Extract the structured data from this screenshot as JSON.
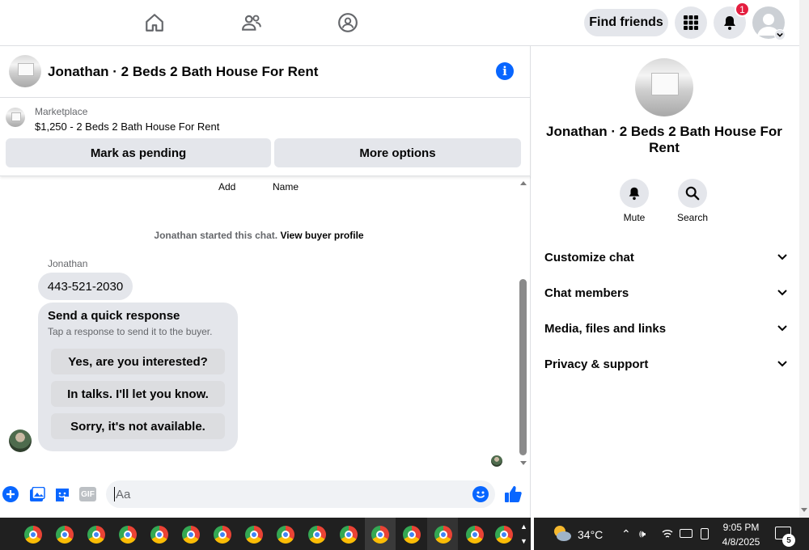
{
  "topnav": {
    "find_friends": "Find friends",
    "notif_count": "1"
  },
  "chat": {
    "title": "Jonathan · 2 Beds 2 Bath House For Rent",
    "marketplace_label": "Marketplace",
    "listing": "$1,250 - 2 Beds 2 Bath House For Rent",
    "mark_pending": "Mark as pending",
    "more_options": "More options",
    "add_label": "Add",
    "name_label": "Name",
    "started_text": "Jonathan started this chat.",
    "view_profile": "View buyer profile",
    "sender": "Jonathan",
    "phone": "443-521-2030",
    "quick_title": "Send a quick response",
    "quick_sub": "Tap a response to send it to the buyer.",
    "quick_responses": [
      "Yes, are you interested?",
      "In talks. I'll let you know.",
      "Sorry, it's not available."
    ],
    "composer_placeholder": "Aa",
    "gif_label": "GIF"
  },
  "details": {
    "title": "Jonathan · 2 Beds 2 Bath House For Rent",
    "mute": "Mute",
    "search": "Search",
    "sections": [
      "Customize chat",
      "Chat members",
      "Media, files and links",
      "Privacy & support"
    ]
  },
  "taskbar": {
    "temp": "34°C",
    "time": "9:05 PM",
    "date": "4/8/2025",
    "notif": "5"
  },
  "colors": {
    "accent": "#0866ff",
    "badge": "#e41e3f"
  }
}
